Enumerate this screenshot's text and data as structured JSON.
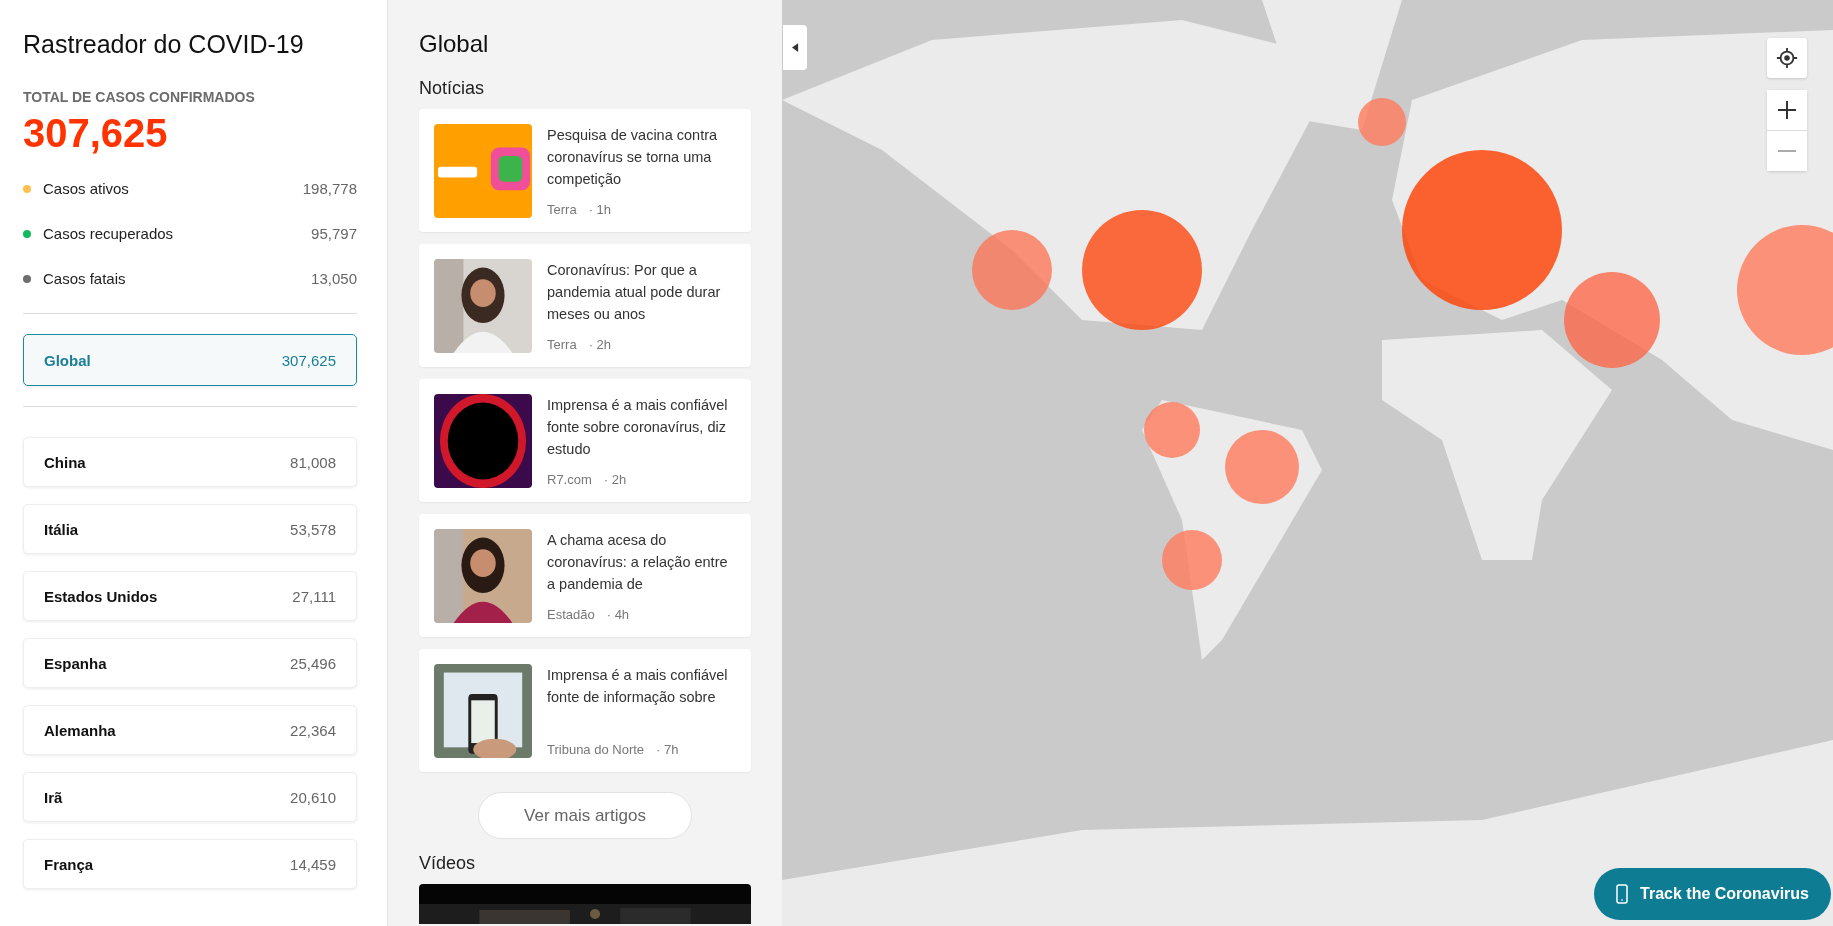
{
  "sidebar": {
    "title": "Rastreador do COVID-19",
    "total_label": "TOTAL DE CASOS CONFIRMADOS",
    "total": "307,625",
    "stats": [
      {
        "label": "Casos ativos",
        "value": "198,778",
        "color": "#ffc04d"
      },
      {
        "label": "Casos recuperados",
        "value": "95,797",
        "color": "#13b95c"
      },
      {
        "label": "Casos fatais",
        "value": "13,050",
        "color": "#6e6e6e"
      }
    ],
    "global": {
      "label": "Global",
      "value": "307,625",
      "selected": true
    },
    "countries": [
      {
        "label": "China",
        "value": "81,008",
        "selected": false
      },
      {
        "label": "Itália",
        "value": "53,578",
        "selected": false
      },
      {
        "label": "Estados Unidos",
        "value": "27,111",
        "selected": false
      },
      {
        "label": "Espanha",
        "value": "25,496",
        "selected": false
      },
      {
        "label": "Alemanha",
        "value": "22,364",
        "selected": false
      },
      {
        "label": "Irã",
        "value": "20,610",
        "selected": false
      },
      {
        "label": "França",
        "value": "14,459",
        "selected": false
      }
    ]
  },
  "feed": {
    "title": "Global",
    "news_heading": "Notícias",
    "news": [
      {
        "title": "Pesquisa de vacina contra coronavírus se torna uma competição",
        "source": "Terra",
        "time": "· 1h"
      },
      {
        "title": "Coronavírus: Por que a pandemia atual pode durar meses ou anos",
        "source": "Terra",
        "time": "· 2h"
      },
      {
        "title": "Imprensa é a mais confiável fonte sobre coronavírus, diz estudo",
        "source": "R7.com",
        "time": "· 2h"
      },
      {
        "title": "A chama acesa do coronavírus: a relação entre a pandemia de",
        "source": "Estadão",
        "time": "· 4h"
      },
      {
        "title": "Imprensa é a mais confiável fonte de informação sobre",
        "source": "Tribuna do Norte",
        "time": "· 7h"
      }
    ],
    "more_button": "Ver mais artigos",
    "videos_heading": "Vídeos"
  },
  "map": {
    "track_button": "Track the Coronavirus"
  }
}
